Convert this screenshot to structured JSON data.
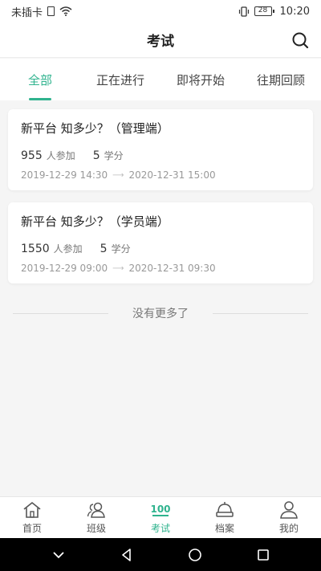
{
  "status_bar": {
    "carrier": "未插卡",
    "battery": "28",
    "time": "10:20"
  },
  "header": {
    "title": "考试"
  },
  "tabs": [
    {
      "label": "全部",
      "active": true
    },
    {
      "label": "正在进行",
      "active": false
    },
    {
      "label": "即将开始",
      "active": false
    },
    {
      "label": "往期回顾",
      "active": false
    }
  ],
  "exams": [
    {
      "title": "新平台 知多少？（管理端）",
      "participants": "955",
      "participants_unit": "人参加",
      "credits": "5",
      "credits_unit": "学分",
      "start": "2019-12-29 14:30",
      "end": "2020-12-31 15:00"
    },
    {
      "title": "新平台 知多少？（学员端）",
      "participants": "1550",
      "participants_unit": "人参加",
      "credits": "5",
      "credits_unit": "学分",
      "start": "2019-12-29 09:00",
      "end": "2020-12-31 09:30"
    }
  ],
  "list_footer": "没有更多了",
  "bottom_nav": [
    {
      "label": "首页",
      "icon": "home-icon"
    },
    {
      "label": "班级",
      "icon": "class-icon"
    },
    {
      "label": "考试",
      "icon": "exam-100-icon",
      "badge": "100"
    },
    {
      "label": "档案",
      "icon": "archive-icon"
    },
    {
      "label": "我的",
      "icon": "user-icon"
    }
  ],
  "colors": {
    "accent": "#2fb38e"
  }
}
